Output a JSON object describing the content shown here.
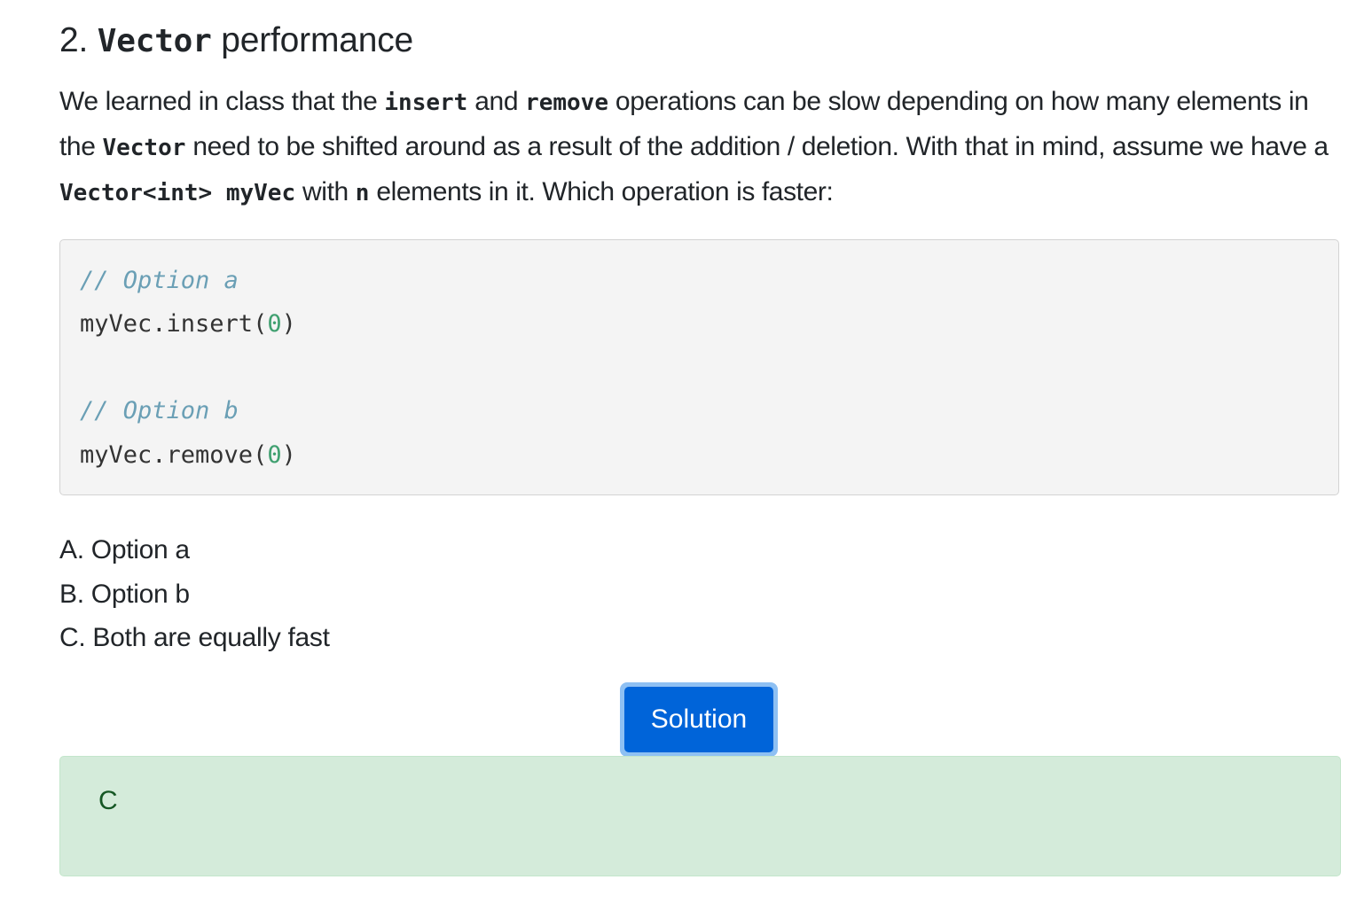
{
  "heading": {
    "number": "2.",
    "code_word": "Vector",
    "rest": "performance"
  },
  "question": {
    "t1": "We learned in class that the",
    "c1": "insert",
    "t2": "and",
    "c2": "remove",
    "t3": "operations can be slow depending on how many elements in the",
    "c3": "Vector",
    "t4": "need to be shifted around as a result of the addition / deletion. With that in mind, assume we have a",
    "c4": "Vector<int> myVec",
    "t5": "with",
    "c5": "n",
    "t6": "elements in it. Which operation is faster:"
  },
  "code": {
    "comment_a": "// Option a",
    "line_a_prefix": "myVec.insert(",
    "line_a_arg": "0",
    "line_a_suffix": ")",
    "comment_b": "// Option b",
    "line_b_prefix": "myVec.remove(",
    "line_b_arg": "0",
    "line_b_suffix": ")"
  },
  "choices": [
    "A. Option a",
    "B. Option b",
    "C. Both are equally fast"
  ],
  "solution_button": "Solution",
  "answer": "C",
  "colors": {
    "button_bg": "#0064d9",
    "button_focus_ring": "#8ec0f3",
    "answer_bg": "#d4ebda",
    "code_bg": "#f4f4f4",
    "comment": "#6a9fb5",
    "number_literal": "#40a070"
  }
}
